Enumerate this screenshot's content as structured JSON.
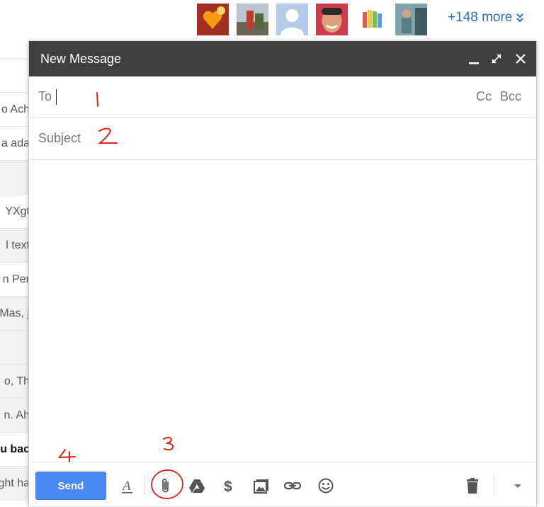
{
  "people_strip": {
    "avatars": [
      {
        "name": "avatar-heart-photo",
        "color": "#c0392b"
      },
      {
        "name": "avatar-street-photo",
        "color": "#8a7f6a"
      },
      {
        "name": "avatar-default",
        "color": "#a9c1e8"
      },
      {
        "name": "avatar-face-photo",
        "color": "#d89a6a"
      },
      {
        "name": "avatar-cards-photo",
        "color": "#9bcf5b"
      },
      {
        "name": "avatar-person-photo",
        "color": "#4b6f7a"
      }
    ],
    "more_label": "+148 more"
  },
  "inbox_rows": [
    "o Ach",
    "a ada",
    "",
    "YXgt",
    "l text",
    "n Per",
    "Mas, j",
    "",
    "o, Th",
    "n. Ah",
    "u bac",
    "ght ha"
  ],
  "compose": {
    "title": "New Message",
    "to_label": "To",
    "cc_label": "Cc",
    "bcc_label": "Bcc",
    "subject_placeholder": "Subject",
    "send_label": "Send"
  },
  "annotations": [
    "1",
    "2",
    "3",
    "4"
  ],
  "colors": {
    "titlebar": "#404040",
    "send": "#4a8af4",
    "annotation": "#e0221b",
    "link": "#2a6dc9"
  }
}
